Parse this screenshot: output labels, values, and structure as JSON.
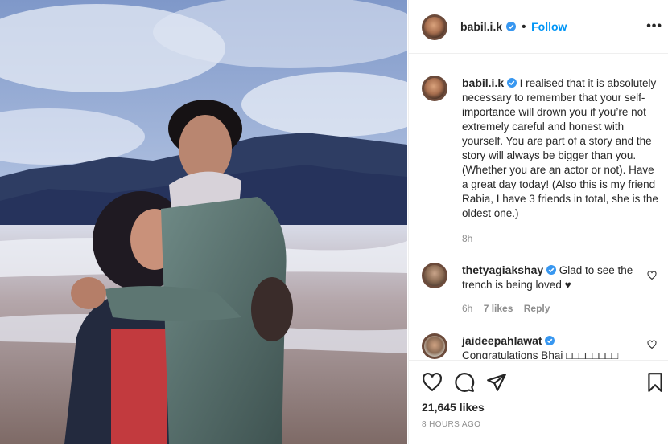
{
  "post": {
    "username": "babil.i.k",
    "follow_label": "Follow",
    "separator": "•",
    "more_label": "•••",
    "caption": "I realised that it is absolutely necessary to remember that your self-importance will drown you if you’re not extremely careful and honest with yourself. You are part of a story and the story will always be bigger than you. (Whether you are an actor or not). Have a great day today! (Also this is my friend Rabia, I have 3 friends in total, she is the oldest one.)",
    "caption_age": "8h",
    "likes": "21,645 likes",
    "posted": "8 HOURS AGO"
  },
  "comments": [
    {
      "username": "thetyagiakshay",
      "text": "Glad to see the trench is being loved ♥",
      "age": "6h",
      "likes": "7 likes",
      "reply_label": "Reply"
    },
    {
      "username": "jaideepahlawat",
      "text": "Congratulations Bhai □□□□□□□□",
      "age": "",
      "likes": "",
      "reply_label": ""
    }
  ],
  "colors": {
    "accent": "#0095f6",
    "muted": "#8e8e8e",
    "text": "#262626",
    "border": "#efefef"
  },
  "icons": [
    "verified-badge-icon",
    "more-options-icon",
    "heart-icon",
    "comment-icon",
    "share-icon",
    "bookmark-icon"
  ]
}
